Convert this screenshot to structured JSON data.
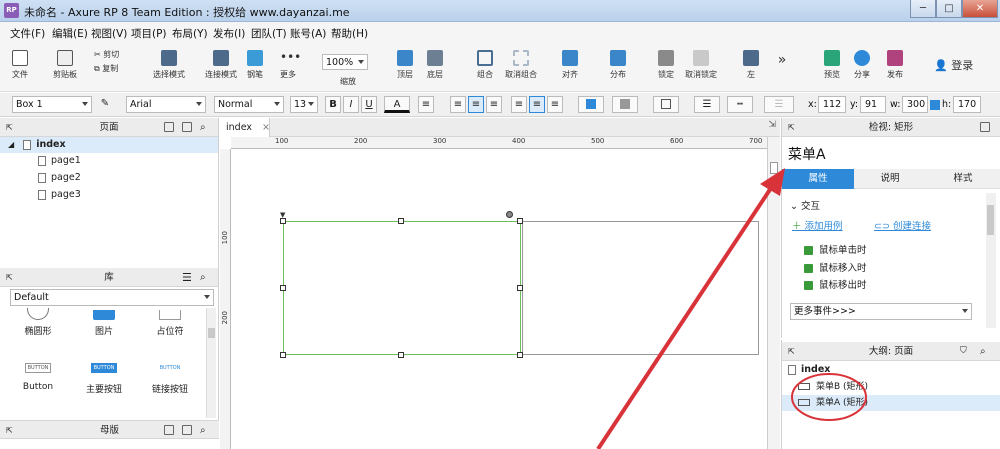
{
  "window": {
    "title": "未命名 - Axure RP 8 Team Edition : 授权给 www.dayanzai.me",
    "app_icon": "RP",
    "btn_min": "─",
    "btn_max": "□",
    "btn_close": "✕"
  },
  "menu": [
    "文件(F)",
    "编辑(E)",
    "视图(V)",
    "项目(P)",
    "布局(Y)",
    "发布(I)",
    "团队(T)",
    "账号(A)",
    "帮助(H)"
  ],
  "toolbar": {
    "file": "文件",
    "paste": "剪贴板",
    "cut": "剪切",
    "copy": "复制",
    "select": "选择模式",
    "connect": "连接模式",
    "pen": "钢笔",
    "more": "更多",
    "zoom": "100%",
    "zoom_label": "缩放",
    "top": "顶层",
    "bottom": "底层",
    "group": "组合",
    "ungroup": "取消组合",
    "align": "对齐",
    "distribute": "分布",
    "lock": "锁定",
    "unlock": "取消锁定",
    "left": "左",
    "preview": "预览",
    "share": "分享",
    "publish": "发布",
    "login": "登录",
    "expand": "»"
  },
  "format": {
    "widget_name": "Box 1",
    "font": "Arial",
    "style": "Normal",
    "size": "13",
    "bold": "B",
    "italic": "I",
    "underline": "U",
    "text_color": "A",
    "x_label": "x:",
    "x": "112",
    "y_label": "y:",
    "y": "91",
    "w_label": "w:",
    "w": "300",
    "h_label": "h:",
    "h": "170"
  },
  "pages": {
    "header": "页面",
    "root": "index",
    "children": [
      "page1",
      "page2",
      "page3"
    ]
  },
  "library": {
    "header": "库",
    "selected": "Default",
    "widgets": [
      {
        "label": "椭圆形"
      },
      {
        "label": "图片"
      },
      {
        "label": "占位符"
      },
      {
        "label": "Button",
        "preview": "BUTTON"
      },
      {
        "label": "主要按钮",
        "preview": "BUTTON"
      },
      {
        "label": "链接按钮",
        "preview": "BUTTON"
      }
    ]
  },
  "masters": {
    "header": "母版"
  },
  "canvas": {
    "tab": "index",
    "tab_close": "×",
    "ruler_top": [
      "100",
      "200",
      "300",
      "400",
      "500",
      "600",
      "700"
    ],
    "ruler_left": [
      "100",
      "200"
    ]
  },
  "inspector": {
    "header": "检视: 矩形",
    "name": "菜单A",
    "tabs": [
      "属性",
      "说明",
      "样式"
    ],
    "section": "交互",
    "add_case": "添加用例",
    "create_link": "创建连接",
    "events": [
      "鼠标单击时",
      "鼠标移入时",
      "鼠标移出时"
    ],
    "more_events": "更多事件>>>"
  },
  "outline": {
    "header": "大纲: 页面",
    "root": "index",
    "items": [
      "菜单B (矩形)",
      "菜单A (矩形)"
    ]
  },
  "colors": {
    "accent": "#2e8ad8",
    "annotation": "#d9333a",
    "selection_green": "#6dbf5a"
  }
}
